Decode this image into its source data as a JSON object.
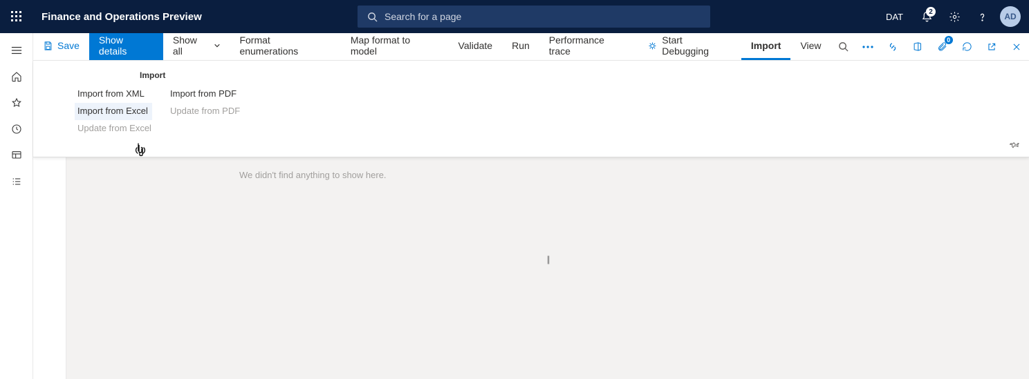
{
  "header": {
    "app_title": "Finance and Operations Preview",
    "search_placeholder": "Search for a page",
    "company": "DAT",
    "avatar_initials": "AD",
    "notification_count": "2"
  },
  "actionbar": {
    "save": "Save",
    "show_details": "Show details",
    "show_all": "Show all",
    "format_enum": "Format enumerations",
    "map_format": "Map format to model",
    "validate": "Validate",
    "run": "Run",
    "perf_trace": "Performance trace",
    "start_debug": "Start Debugging",
    "import": "Import",
    "view": "View",
    "attach_badge": "0"
  },
  "dropdown": {
    "title": "Import",
    "col1": [
      {
        "label": "Import from XML",
        "disabled": false,
        "hover": false
      },
      {
        "label": "Import from Excel",
        "disabled": false,
        "hover": true
      },
      {
        "label": "Update from Excel",
        "disabled": true,
        "hover": false
      }
    ],
    "col2": [
      {
        "label": "Import from PDF",
        "disabled": false,
        "hover": false
      },
      {
        "label": "Update from PDF",
        "disabled": true,
        "hover": false
      }
    ]
  },
  "content": {
    "empty_message": "We didn't find anything to show here."
  }
}
